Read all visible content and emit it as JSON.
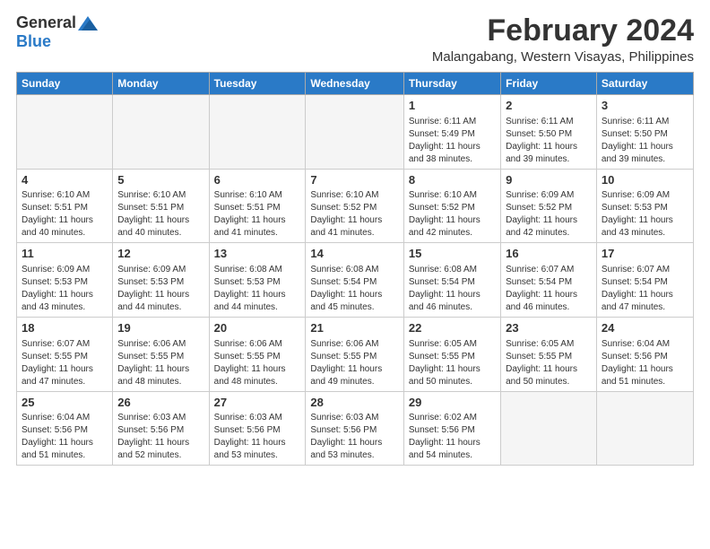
{
  "logo": {
    "general": "General",
    "blue": "Blue"
  },
  "title": "February 2024",
  "subtitle": "Malangabang, Western Visayas, Philippines",
  "days_of_week": [
    "Sunday",
    "Monday",
    "Tuesday",
    "Wednesday",
    "Thursday",
    "Friday",
    "Saturday"
  ],
  "weeks": [
    [
      {
        "day": "",
        "info": ""
      },
      {
        "day": "",
        "info": ""
      },
      {
        "day": "",
        "info": ""
      },
      {
        "day": "",
        "info": ""
      },
      {
        "day": "1",
        "info": "Sunrise: 6:11 AM\nSunset: 5:49 PM\nDaylight: 11 hours\nand 38 minutes."
      },
      {
        "day": "2",
        "info": "Sunrise: 6:11 AM\nSunset: 5:50 PM\nDaylight: 11 hours\nand 39 minutes."
      },
      {
        "day": "3",
        "info": "Sunrise: 6:11 AM\nSunset: 5:50 PM\nDaylight: 11 hours\nand 39 minutes."
      }
    ],
    [
      {
        "day": "4",
        "info": "Sunrise: 6:10 AM\nSunset: 5:51 PM\nDaylight: 11 hours\nand 40 minutes."
      },
      {
        "day": "5",
        "info": "Sunrise: 6:10 AM\nSunset: 5:51 PM\nDaylight: 11 hours\nand 40 minutes."
      },
      {
        "day": "6",
        "info": "Sunrise: 6:10 AM\nSunset: 5:51 PM\nDaylight: 11 hours\nand 41 minutes."
      },
      {
        "day": "7",
        "info": "Sunrise: 6:10 AM\nSunset: 5:52 PM\nDaylight: 11 hours\nand 41 minutes."
      },
      {
        "day": "8",
        "info": "Sunrise: 6:10 AM\nSunset: 5:52 PM\nDaylight: 11 hours\nand 42 minutes."
      },
      {
        "day": "9",
        "info": "Sunrise: 6:09 AM\nSunset: 5:52 PM\nDaylight: 11 hours\nand 42 minutes."
      },
      {
        "day": "10",
        "info": "Sunrise: 6:09 AM\nSunset: 5:53 PM\nDaylight: 11 hours\nand 43 minutes."
      }
    ],
    [
      {
        "day": "11",
        "info": "Sunrise: 6:09 AM\nSunset: 5:53 PM\nDaylight: 11 hours\nand 43 minutes."
      },
      {
        "day": "12",
        "info": "Sunrise: 6:09 AM\nSunset: 5:53 PM\nDaylight: 11 hours\nand 44 minutes."
      },
      {
        "day": "13",
        "info": "Sunrise: 6:08 AM\nSunset: 5:53 PM\nDaylight: 11 hours\nand 44 minutes."
      },
      {
        "day": "14",
        "info": "Sunrise: 6:08 AM\nSunset: 5:54 PM\nDaylight: 11 hours\nand 45 minutes."
      },
      {
        "day": "15",
        "info": "Sunrise: 6:08 AM\nSunset: 5:54 PM\nDaylight: 11 hours\nand 46 minutes."
      },
      {
        "day": "16",
        "info": "Sunrise: 6:07 AM\nSunset: 5:54 PM\nDaylight: 11 hours\nand 46 minutes."
      },
      {
        "day": "17",
        "info": "Sunrise: 6:07 AM\nSunset: 5:54 PM\nDaylight: 11 hours\nand 47 minutes."
      }
    ],
    [
      {
        "day": "18",
        "info": "Sunrise: 6:07 AM\nSunset: 5:55 PM\nDaylight: 11 hours\nand 47 minutes."
      },
      {
        "day": "19",
        "info": "Sunrise: 6:06 AM\nSunset: 5:55 PM\nDaylight: 11 hours\nand 48 minutes."
      },
      {
        "day": "20",
        "info": "Sunrise: 6:06 AM\nSunset: 5:55 PM\nDaylight: 11 hours\nand 48 minutes."
      },
      {
        "day": "21",
        "info": "Sunrise: 6:06 AM\nSunset: 5:55 PM\nDaylight: 11 hours\nand 49 minutes."
      },
      {
        "day": "22",
        "info": "Sunrise: 6:05 AM\nSunset: 5:55 PM\nDaylight: 11 hours\nand 50 minutes."
      },
      {
        "day": "23",
        "info": "Sunrise: 6:05 AM\nSunset: 5:55 PM\nDaylight: 11 hours\nand 50 minutes."
      },
      {
        "day": "24",
        "info": "Sunrise: 6:04 AM\nSunset: 5:56 PM\nDaylight: 11 hours\nand 51 minutes."
      }
    ],
    [
      {
        "day": "25",
        "info": "Sunrise: 6:04 AM\nSunset: 5:56 PM\nDaylight: 11 hours\nand 51 minutes."
      },
      {
        "day": "26",
        "info": "Sunrise: 6:03 AM\nSunset: 5:56 PM\nDaylight: 11 hours\nand 52 minutes."
      },
      {
        "day": "27",
        "info": "Sunrise: 6:03 AM\nSunset: 5:56 PM\nDaylight: 11 hours\nand 53 minutes."
      },
      {
        "day": "28",
        "info": "Sunrise: 6:03 AM\nSunset: 5:56 PM\nDaylight: 11 hours\nand 53 minutes."
      },
      {
        "day": "29",
        "info": "Sunrise: 6:02 AM\nSunset: 5:56 PM\nDaylight: 11 hours\nand 54 minutes."
      },
      {
        "day": "",
        "info": ""
      },
      {
        "day": "",
        "info": ""
      }
    ]
  ]
}
